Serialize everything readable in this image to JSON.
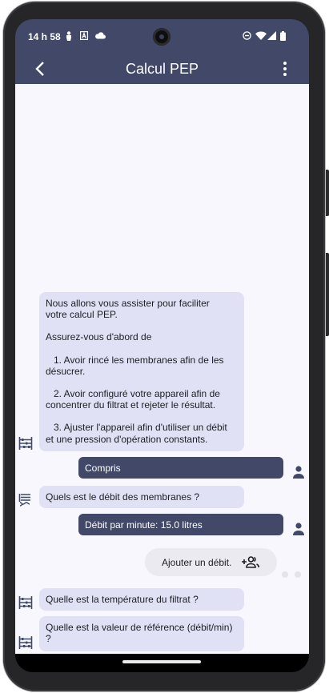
{
  "status_bar": {
    "time": "14 h 58",
    "icons": [
      "person-icon",
      "a-box-icon",
      "cloud-icon",
      "dnd-icon",
      "wifi-icon",
      "signal-icon",
      "battery-icon"
    ]
  },
  "app_bar": {
    "title": "Calcul PEP",
    "back_icon": "arrow-back-icon",
    "menu_icon": "more-vert-icon"
  },
  "messages": [
    {
      "sender": "bot",
      "avatar": "abacus-icon",
      "lines": [
        "Nous allons vous assister pour faciliter",
        "votre calcul PEP.",
        "",
        "Assurez-vous d'abord de",
        "",
        "   1. Avoir rincé les membranes afin de les",
        "désucrer.",
        "",
        "   2. Avoir configuré votre appareil afin de",
        "concentrer du filtrat et rejeter le résultat.",
        "",
        "   3. Ajuster l'appareil afin d'utiliser un débit",
        "et une pression d'opération constants."
      ]
    },
    {
      "sender": "user",
      "avatar": "person-icon",
      "text": "Compris"
    },
    {
      "sender": "bot",
      "avatar": "filter-icon",
      "text": "Quels est le débit des membranes ?"
    },
    {
      "sender": "user",
      "avatar": "person-icon",
      "text": "Débit par minute: 15.0 litres"
    },
    {
      "sender": "bot",
      "avatar": "abacus-icon",
      "text": "Quelle est la température du filtrat ?"
    },
    {
      "sender": "bot",
      "avatar": "abacus-icon",
      "lines": [
        "Quelle est la valeur de référence (débit/min)",
        "?"
      ]
    }
  ],
  "suggestion_chip": {
    "label": "Ajouter un débit.",
    "icon": "group-add-icon"
  },
  "colors": {
    "primary": "#414868",
    "bot_bubble": "#e1e1f5",
    "background": "#f8f7fd",
    "chip": "#ebeaf0"
  }
}
